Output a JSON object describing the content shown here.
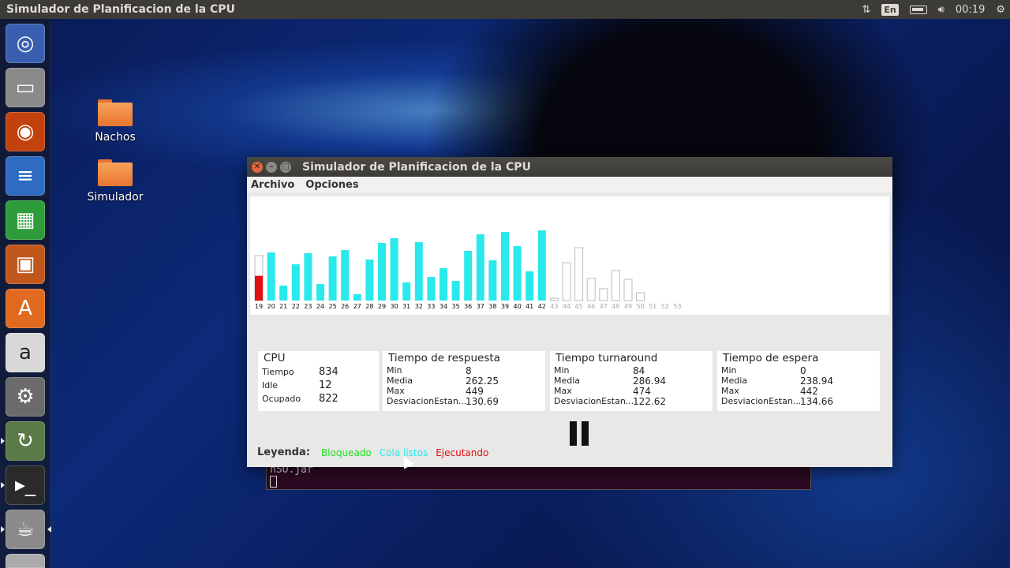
{
  "top_panel": {
    "title": "Simulador de Planificacion de la CPU",
    "keyboard": "En",
    "clock": "00:19"
  },
  "launcher": {
    "items": [
      "ubuntu-dash-icon",
      "files-icon",
      "firefox-icon",
      "writer-icon",
      "calc-icon",
      "impress-icon",
      "software-center-icon",
      "amazon-icon",
      "system-settings-icon",
      "software-updater-icon",
      "terminal-icon",
      "java-icon",
      "trash-icon"
    ]
  },
  "desktop": {
    "icons": [
      {
        "label": "Nachos"
      },
      {
        "label": "Simulador"
      }
    ]
  },
  "terminal": {
    "text": "nSO.jar"
  },
  "window": {
    "title": "Simulador de Planificacion de la CPU",
    "menu": [
      "Archivo",
      "Opciones"
    ]
  },
  "chart_data": {
    "type": "bar",
    "categories": [
      "19",
      "20",
      "21",
      "22",
      "23",
      "24",
      "25",
      "26",
      "27",
      "28",
      "29",
      "30",
      "31",
      "32",
      "33",
      "34",
      "35",
      "36",
      "37",
      "38",
      "39",
      "40",
      "41",
      "42",
      "43",
      "44",
      "45",
      "46",
      "47",
      "48",
      "49",
      "50",
      "51",
      "52",
      "53"
    ],
    "values": [
      57,
      61,
      19,
      46,
      60,
      21,
      56,
      64,
      8,
      52,
      73,
      79,
      23,
      74,
      30,
      41,
      25,
      63,
      84,
      51,
      87,
      69,
      37,
      89,
      3,
      48,
      67,
      28,
      15,
      38,
      27,
      10,
      0,
      0,
      0
    ],
    "states": [
      "ejecutando",
      "listo",
      "listo",
      "listo",
      "listo",
      "listo",
      "listo",
      "listo",
      "listo",
      "listo",
      "listo",
      "listo",
      "listo",
      "listo",
      "listo",
      "listo",
      "listo",
      "listo",
      "listo",
      "listo",
      "listo",
      "listo",
      "listo",
      "listo",
      "pendiente",
      "pendiente",
      "pendiente",
      "pendiente",
      "pendiente",
      "pendiente",
      "pendiente",
      "pendiente",
      "pendiente",
      "pendiente",
      "pendiente"
    ],
    "executed_fraction": [
      0.55
    ],
    "ylim": [
      0,
      100
    ],
    "colors": {
      "listo": "#29e9ec",
      "ejecutando": "#e01010",
      "pendiente": "#ffffff",
      "outline": "#bbbbbb"
    }
  },
  "stats": {
    "cpu": {
      "title": "CPU",
      "rows": [
        {
          "k": "Tiempo",
          "v": "834"
        },
        {
          "k": "Idle",
          "v": "12"
        },
        {
          "k": "Ocupado",
          "v": "822"
        }
      ]
    },
    "respuesta": {
      "title": "Tiempo de respuesta",
      "rows": [
        {
          "k": "Min",
          "v": "8"
        },
        {
          "k": "Media",
          "v": "262.25"
        },
        {
          "k": "Max",
          "v": "449"
        },
        {
          "k": "DesviacionEstan...",
          "v": "130.69"
        }
      ]
    },
    "turnaround": {
      "title": "Tiempo turnaround",
      "rows": [
        {
          "k": "Min",
          "v": "84"
        },
        {
          "k": "Media",
          "v": "286.94"
        },
        {
          "k": "Max",
          "v": "474"
        },
        {
          "k": "DesviacionEstan...",
          "v": "122.62"
        }
      ]
    },
    "espera": {
      "title": "Tiempo de espera",
      "rows": [
        {
          "k": "Min",
          "v": "0"
        },
        {
          "k": "Media",
          "v": "238.94"
        },
        {
          "k": "Max",
          "v": "442"
        },
        {
          "k": "DesviacionEstan...",
          "v": "134.66"
        }
      ]
    }
  },
  "legend": {
    "label": "Leyenda:",
    "items": [
      {
        "text": "Bloqueado",
        "color": "#22dd22"
      },
      {
        "text": "Cola listos",
        "color": "#29e9ec"
      },
      {
        "text": "Ejecutando",
        "color": "#e01010"
      }
    ]
  }
}
